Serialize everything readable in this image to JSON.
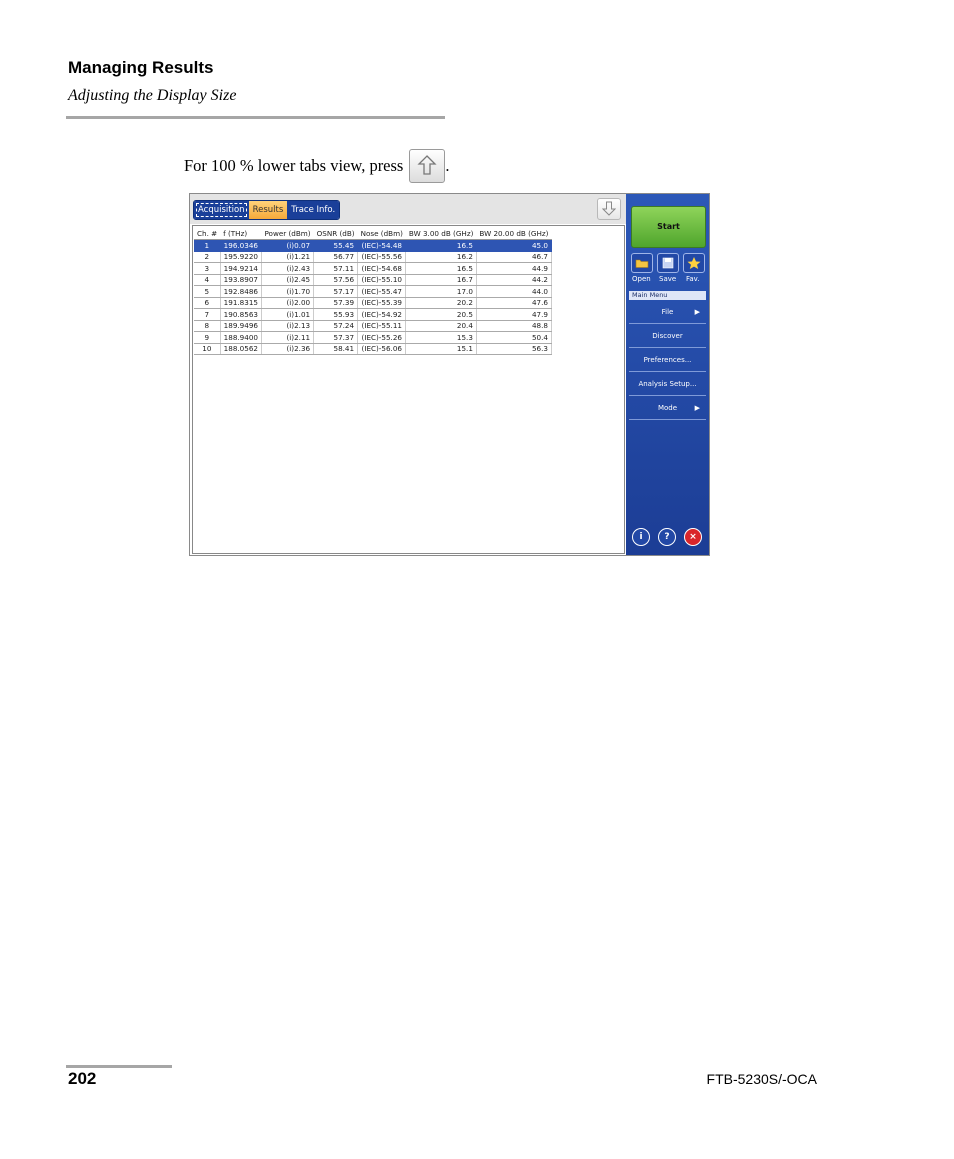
{
  "header": {
    "title": "Managing Results",
    "subtitle": "Adjusting the Display Size"
  },
  "instruction": {
    "text": "For 100 % lower tabs view, press",
    "suffix": ".",
    "icon": "up-arrow-icon"
  },
  "app": {
    "tabs": [
      {
        "label": "Acquisition",
        "active": false
      },
      {
        "label": "Results",
        "active": true
      },
      {
        "label": "Trace Info.",
        "active": false
      }
    ],
    "table": {
      "columns": [
        "Ch. #",
        "f (THz)",
        "Power (dBm)",
        "OSNR (dB)",
        "Nose (dBm)",
        "BW 3.00 dB (GHz)",
        "BW 20.00 dB (GHz)"
      ],
      "rows": [
        [
          "1",
          "196.0346",
          "(i)0.07",
          "55.45",
          "(IEC)-54.48",
          "16.5",
          "45.0"
        ],
        [
          "2",
          "195.9220",
          "(i)1.21",
          "56.77",
          "(IEC)-55.56",
          "16.2",
          "46.7"
        ],
        [
          "3",
          "194.9214",
          "(i)2.43",
          "57.11",
          "(IEC)-54.68",
          "16.5",
          "44.9"
        ],
        [
          "4",
          "193.8907",
          "(i)2.45",
          "57.56",
          "(IEC)-55.10",
          "16.7",
          "44.2"
        ],
        [
          "5",
          "192.8486",
          "(i)1.70",
          "57.17",
          "(IEC)-55.47",
          "17.0",
          "44.0"
        ],
        [
          "6",
          "191.8315",
          "(i)2.00",
          "57.39",
          "(IEC)-55.39",
          "20.2",
          "47.6"
        ],
        [
          "7",
          "190.8563",
          "(i)1.01",
          "55.93",
          "(IEC)-54.92",
          "20.5",
          "47.9"
        ],
        [
          "8",
          "189.9496",
          "(i)2.13",
          "57.24",
          "(IEC)-55.11",
          "20.4",
          "48.8"
        ],
        [
          "9",
          "188.9400",
          "(i)2.11",
          "57.37",
          "(IEC)-55.26",
          "15.3",
          "50.4"
        ],
        [
          "10",
          "188.0562",
          "(i)2.36",
          "58.41",
          "(IEC)-56.06",
          "15.1",
          "56.3"
        ]
      ],
      "selected_row": 0
    },
    "side": {
      "start_label": "Start",
      "quick": [
        {
          "label": "Open",
          "icon": "folder-icon"
        },
        {
          "label": "Save",
          "icon": "disk-icon"
        },
        {
          "label": "Fav.",
          "icon": "star-icon"
        }
      ],
      "menu_title": "Main Menu",
      "menu": [
        {
          "label": "File",
          "submenu": true
        },
        {
          "label": "Discover",
          "submenu": false
        },
        {
          "label": "Preferences...",
          "submenu": false
        },
        {
          "label": "Analysis Setup...",
          "submenu": false
        },
        {
          "label": "Mode",
          "submenu": true
        }
      ],
      "bottom_icons": [
        "info-icon",
        "help-icon",
        "close-icon"
      ]
    },
    "colors": {
      "tab_bar": "#1a3f99",
      "active_tab": "#f6a93a",
      "selection": "#2e55b3",
      "start_button": "#4fa52c",
      "close_button": "#d9262b"
    }
  },
  "footer": {
    "page_number": "202",
    "doc_name": "FTB-5230S/-OCA"
  }
}
